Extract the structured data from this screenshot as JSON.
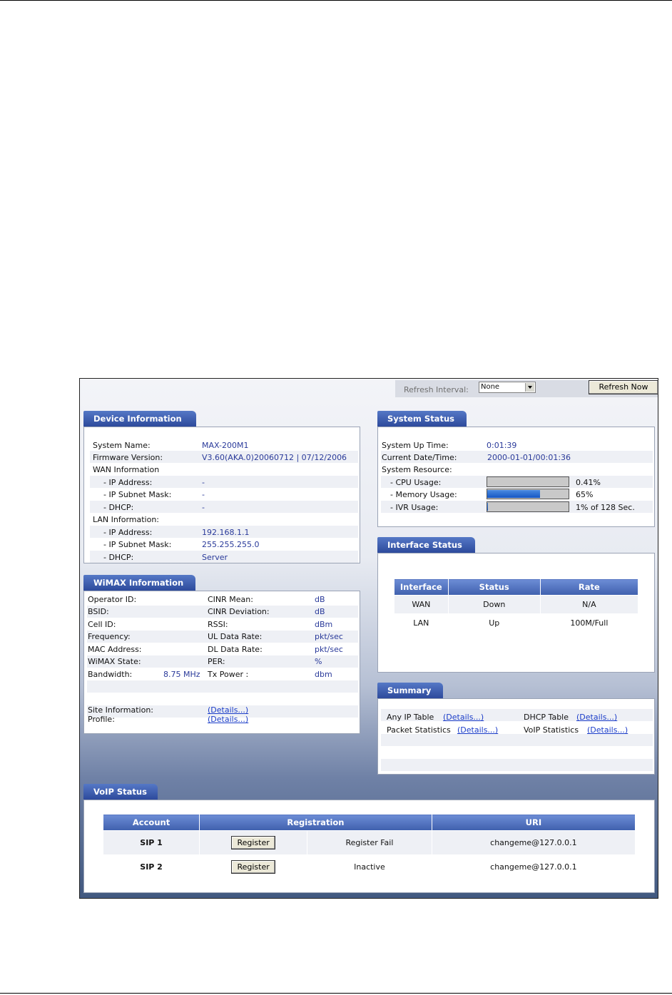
{
  "top_bar": {
    "refresh_interval_label": "Refresh Interval:",
    "refresh_interval_value": "None",
    "refresh_now_label": "Refresh Now"
  },
  "device_info": {
    "title": "Device Information",
    "system_name_label": "System Name:",
    "system_name": "MAX-200M1",
    "firmware_label": "Firmware Version:",
    "firmware": "V3.60(AKA.0)20060712 | 07/12/2006",
    "wan_label": "WAN Information",
    "wan_ip_label": "- IP Address:",
    "wan_ip": "-",
    "wan_mask_label": "- IP Subnet Mask:",
    "wan_mask": "-",
    "wan_dhcp_label": "- DHCP:",
    "wan_dhcp": "-",
    "lan_label": "LAN Information:",
    "lan_ip_label": "- IP Address:",
    "lan_ip": "192.168.1.1",
    "lan_mask_label": "- IP Subnet Mask:",
    "lan_mask": "255.255.255.0",
    "lan_dhcp_label": "- DHCP:",
    "lan_dhcp": "Server"
  },
  "system_status": {
    "title": "System Status",
    "uptime_label": "System Up Time:",
    "uptime": "0:01:39",
    "datetime_label": "Current Date/Time:",
    "datetime": "2000-01-01/00:01:36",
    "resource_label": "System Resource:",
    "cpu_label": "- CPU Usage:",
    "cpu_value": "0.41%",
    "cpu_fraction": 0.0041,
    "memory_label": "- Memory Usage:",
    "memory_value": "65%",
    "memory_fraction": 0.65,
    "ivr_label": "- IVR Usage:",
    "ivr_value": "1% of 128 Sec.",
    "ivr_fraction": 0.01
  },
  "wimax": {
    "title": "WiMAX Information",
    "operator_label": "Operator ID:",
    "bsid_label": "BSID:",
    "cell_label": "Cell ID:",
    "frequency_label": "Frequency:",
    "mac_label": "MAC Address:",
    "state_label": "WiMAX State:",
    "bandwidth_label": "Bandwidth:",
    "bandwidth_value": "8.75 MHz",
    "cinr_mean_label": "CINR Mean:",
    "cinr_mean_unit": "dB",
    "cinr_dev_label": "CINR Deviation:",
    "cinr_dev_unit": "dB",
    "rssi_label": "RSSI:",
    "rssi_unit": "dBm",
    "ul_label": "UL Data Rate:",
    "ul_unit": "pkt/sec",
    "dl_label": "DL Data Rate:",
    "dl_unit": "pkt/sec",
    "per_label": "PER:",
    "per_unit": "%",
    "tx_label": "Tx Power :",
    "tx_unit": "dbm",
    "site_label": "Site Information:",
    "site_link": "(Details...)",
    "profile_label": "Profile:",
    "profile_link": "(Details...)"
  },
  "interface_status": {
    "title": "Interface Status",
    "headers": [
      "Interface",
      "Status",
      "Rate"
    ],
    "rows": [
      {
        "interface": "WAN",
        "status": "Down",
        "rate": "N/A"
      },
      {
        "interface": "LAN",
        "status": "Up",
        "rate": "100M/Full"
      }
    ]
  },
  "summary": {
    "title": "Summary",
    "any_ip_label": "Any IP Table",
    "packet_label": "Packet Statistics",
    "dhcp_label": "DHCP Table",
    "voip_label": "VoIP Statistics",
    "details_link": "(Details...)"
  },
  "voip_status": {
    "title": "VoIP Status",
    "headers": [
      "Account",
      "Registration",
      "URI"
    ],
    "rows": [
      {
        "account": "SIP 1",
        "button": "Register",
        "registration": "Register Fail",
        "uri": "changeme@127.0.0.1"
      },
      {
        "account": "SIP 2",
        "button": "Register",
        "registration": "Inactive",
        "uri": "changeme@127.0.0.1"
      }
    ]
  }
}
